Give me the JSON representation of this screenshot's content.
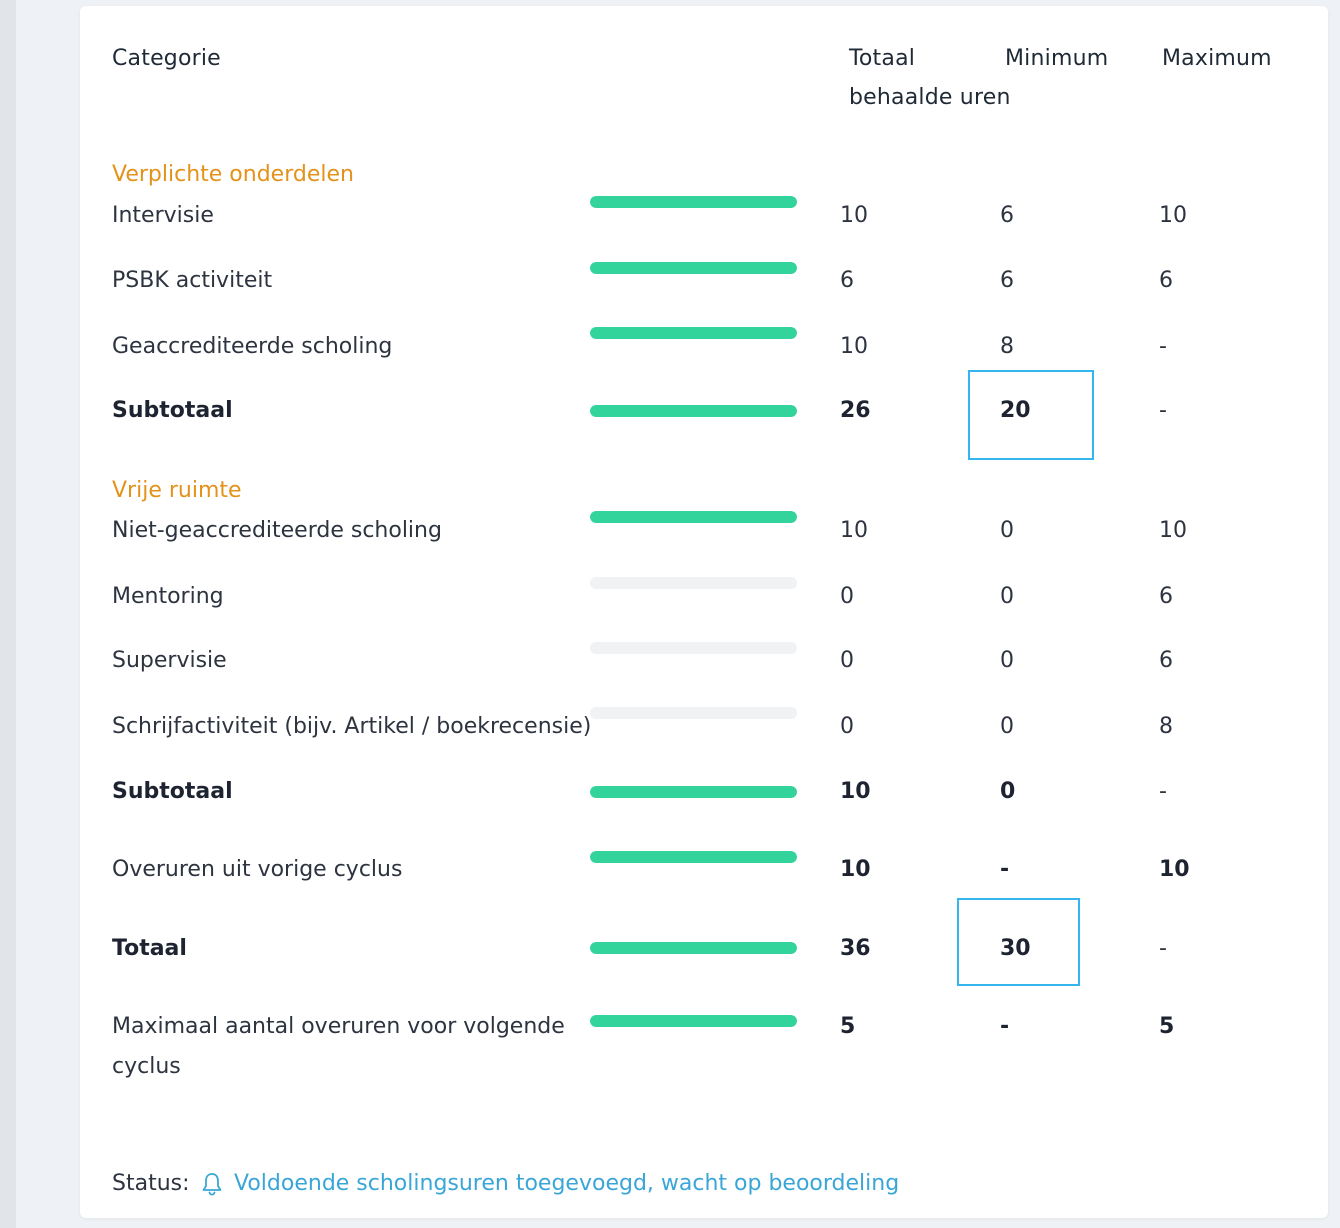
{
  "table": {
    "headers": {
      "category": "Categorie",
      "total_line1": "Totaal",
      "total_line2": "behaalde uren",
      "minimum": "Minimum",
      "maximum": "Maximum"
    },
    "sections": [
      {
        "title": "Verplichte onderdelen",
        "rows": [
          {
            "label": "Intervisie",
            "total": "10",
            "min": "6",
            "max": "10",
            "progress": 1
          },
          {
            "label": "PSBK activiteit",
            "total": "6",
            "min": "6",
            "max": "6",
            "progress": 1
          },
          {
            "label": "Geaccrediteerde scholing",
            "total": "10",
            "min": "8",
            "max": "-",
            "progress": 1
          },
          {
            "label": "Subtotaal",
            "total": "26",
            "min": "20",
            "max": "-",
            "progress": 1
          }
        ]
      },
      {
        "title": "Vrije ruimte",
        "rows": [
          {
            "label": "Niet-geaccrediteerde scholing",
            "total": "10",
            "min": "0",
            "max": "10",
            "progress": 1
          },
          {
            "label": "Mentoring",
            "total": "0",
            "min": "0",
            "max": "6",
            "progress": 0
          },
          {
            "label": "Supervisie",
            "total": "0",
            "min": "0",
            "max": "6",
            "progress": 0
          },
          {
            "label": "Schrijfactiviteit (bijv. Artikel / boekrecensie)",
            "total": "0",
            "min": "0",
            "max": "8",
            "progress": 0
          },
          {
            "label": "Subtotaal",
            "total": "10",
            "min": "0",
            "max": "-",
            "progress": 1
          }
        ]
      }
    ],
    "overtime": {
      "label": "Overuren uit vorige cyclus",
      "total": "10",
      "min": "-",
      "max": "10",
      "progress": 1
    },
    "grand_total": {
      "label": "Totaal",
      "total": "36",
      "min": "30",
      "max": "-",
      "progress": 1
    },
    "max_overtime": {
      "label_line1": "Maximaal aantal overuren voor volgende",
      "label_line2": "cyclus",
      "total": "5",
      "min": "-",
      "max": "5",
      "progress": 1
    }
  },
  "status": {
    "label": "Status:",
    "icon": "bell-icon",
    "text": "Voldoende scholingsuren toegevoegd, wacht op beoordeling"
  },
  "colors": {
    "accent_section": "#e3921a",
    "progress_fill": "#33d39c",
    "progress_track": "#f1f2f4",
    "status_text": "#3aa6d8",
    "highlight_box": "#33b6ee"
  }
}
